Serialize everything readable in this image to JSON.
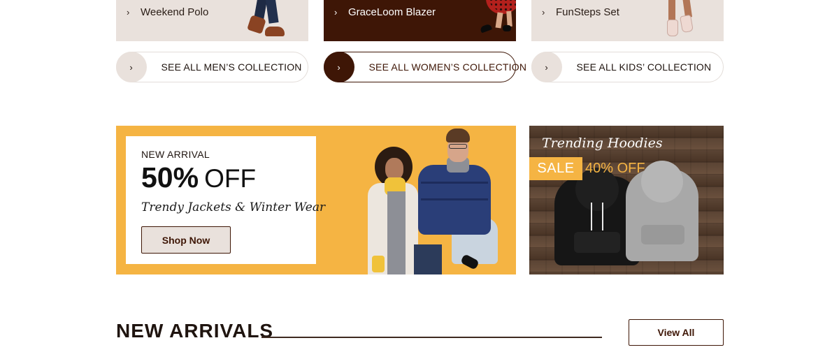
{
  "collections": [
    {
      "item": "Weekend Polo",
      "cta": "SEE ALL MEN’S COLLECTION"
    },
    {
      "item": "GraceLoom Blazer",
      "cta": "SEE ALL WOMEN’S COLLECTION"
    },
    {
      "item": "FunSteps Set",
      "cta": "SEE ALL KIDS’ COLLECTION"
    }
  ],
  "promo": {
    "kicker": "NEW ARRIVAL",
    "percent": "50%",
    "off": "OFF",
    "tagline": "Trendy Jackets & Winter Wear",
    "button": "Shop Now"
  },
  "hoodie_banner": {
    "title": "Trending Hoodies",
    "sale": "SALE",
    "discount": "40% OFF"
  },
  "new_arrivals": {
    "title": "NEW ARRIVALS",
    "view_all": "View All"
  },
  "icons": {
    "chevron": "chevron-right-icon"
  },
  "colors": {
    "brand_brown": "#3e1606",
    "beige": "#e9e1dc",
    "accent_yellow": "#f5b443"
  }
}
